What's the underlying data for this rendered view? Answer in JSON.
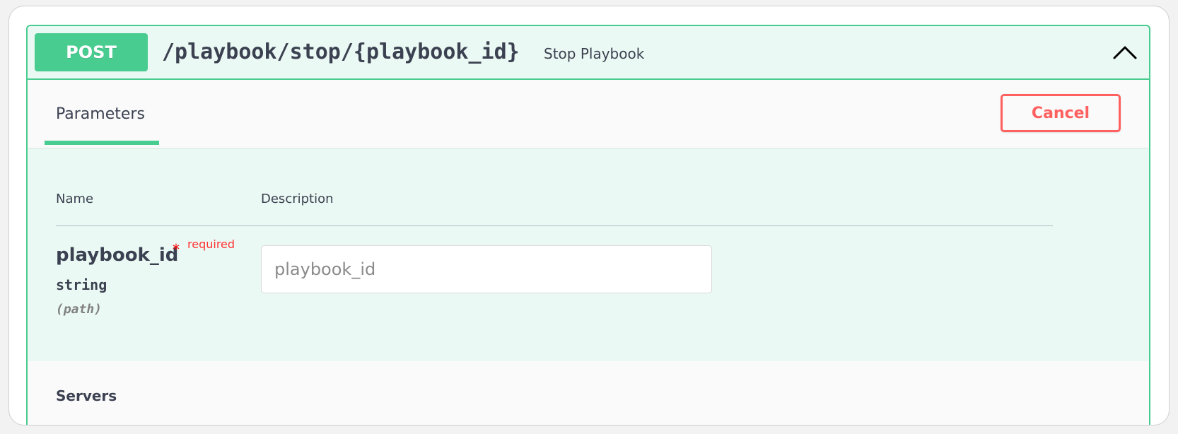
{
  "operation": {
    "method": "POST",
    "path": "/playbook/stop/{playbook_id}",
    "summary": "Stop Playbook",
    "method_color": "#49cc90"
  },
  "section_header": {
    "tab_label": "Parameters",
    "cancel_label": "Cancel",
    "cancel_color": "#ff6060"
  },
  "parameters": {
    "columns": {
      "name": "Name",
      "description": "Description"
    },
    "items": [
      {
        "name": "playbook_id",
        "required_mark": "*",
        "required_label": "required",
        "type": "string",
        "in": "(path)",
        "placeholder": "playbook_id",
        "value": ""
      }
    ]
  },
  "servers": {
    "label": "Servers"
  },
  "icons": {
    "collapse": "chevron-up-icon"
  }
}
